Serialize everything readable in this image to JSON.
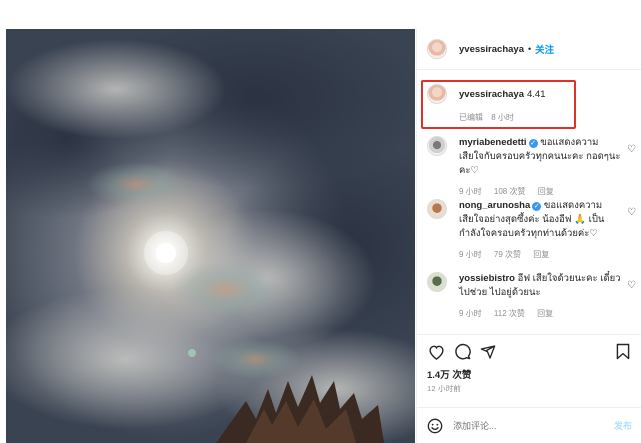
{
  "post": {
    "author": "yvessirachaya",
    "dot": "•",
    "follow_label": "关注"
  },
  "caption": {
    "username": "yvessirachaya",
    "text": "4.41",
    "edited_label": "已编辑",
    "time": "8 小时"
  },
  "comments": [
    {
      "username": "myriabenedetti",
      "verified": true,
      "text": "ขอแสดงความเสียใจกับครอบครัวทุกคนนะคะ กอดๆนะคะ♡",
      "time": "9 小时",
      "likes": "108 次赞",
      "reply": "回复"
    },
    {
      "username": "nong_arunosha",
      "verified": true,
      "text": "ขอแสดงความเสียใจอย่างสุดซึ้งค่ะ น้องอีฟ 🙏 เป็นกำลังใจครอบครัวทุกท่านด้วยค่ะ♡",
      "time": "9 小时",
      "likes": "79 次赞",
      "reply": "回复"
    },
    {
      "username": "yossiebistro",
      "verified": false,
      "text": "อีฟ เสียใจด้วยนะคะ เดี๋ยวไปช่วย ไปอยู่ด้วยนะ",
      "time": "9 小时",
      "likes": "112 次赞",
      "reply": "回复"
    }
  ],
  "actions": {
    "like_icon": "heart-icon",
    "comment_icon": "comment-icon",
    "share_icon": "share-icon",
    "save_icon": "bookmark-icon"
  },
  "likes_count": "1.4万 次赞",
  "posted_ago": "12 小时前",
  "add_comment": {
    "placeholder": "添加评论...",
    "post_label": "发布",
    "emoji_icon": "smiley-icon"
  },
  "colors": {
    "accent": "#0095f6",
    "highlight_box": "#e0302a",
    "muted": "#8e8e8e"
  }
}
